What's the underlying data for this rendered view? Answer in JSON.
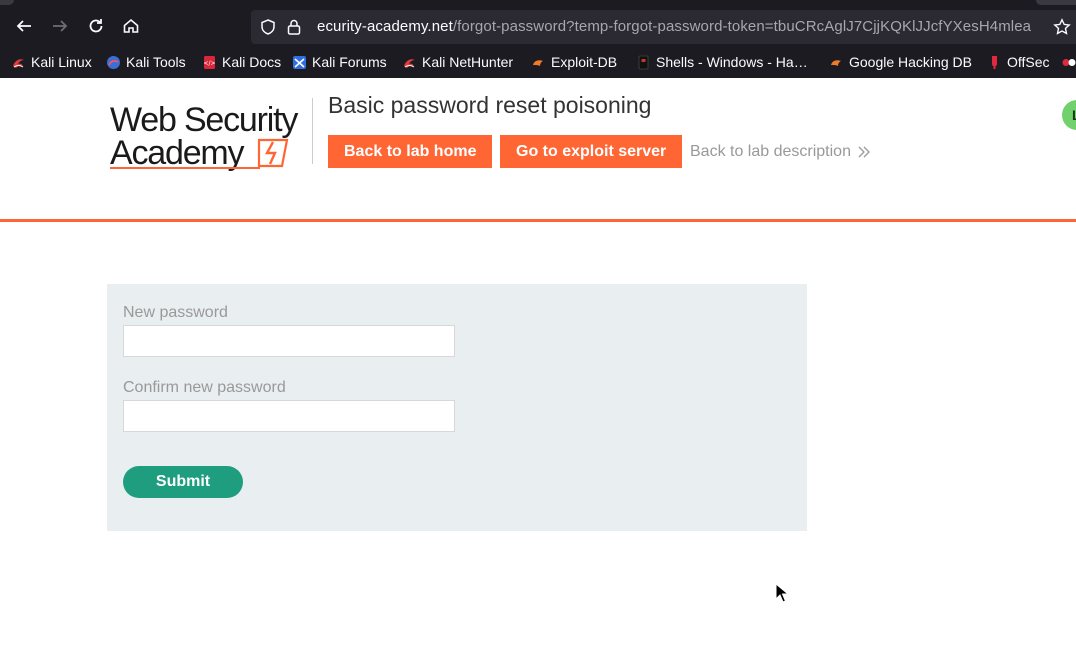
{
  "browser": {
    "url_host": "ecurity-academy.net",
    "url_path": "/forgot-password?temp-forgot-password-token=tbuCRcAglJ7CjjKQKlJJcfYXesH4mlea",
    "bookmarks": [
      {
        "label": "Kali Linux",
        "icon": "kali-dragon-icon"
      },
      {
        "label": "Kali Tools",
        "icon": "kali-tools-icon"
      },
      {
        "label": "Kali Docs",
        "icon": "kali-docs-icon"
      },
      {
        "label": "Kali Forums",
        "icon": "kali-forums-icon"
      },
      {
        "label": "Kali NetHunter",
        "icon": "kali-nethunter-icon"
      },
      {
        "label": "Exploit-DB",
        "icon": "exploit-db-icon"
      },
      {
        "label": "Shells - Windows - Ha…",
        "icon": "shells-icon"
      },
      {
        "label": "Google Hacking DB",
        "icon": "ghdb-icon"
      },
      {
        "label": "OffSec",
        "icon": "offsec-icon"
      }
    ]
  },
  "header": {
    "logo_line1": "Web Security",
    "logo_line2": "Academy",
    "lab_title": "Basic password reset poisoning",
    "back_to_lab_home": "Back to lab home",
    "go_to_exploit_server": "Go to exploit server",
    "back_to_lab_description": "Back to lab description",
    "status_initial": "L"
  },
  "form": {
    "new_password_label": "New password",
    "new_password_value": "",
    "confirm_password_label": "Confirm new password",
    "confirm_password_value": "",
    "submit_label": "Submit"
  },
  "colors": {
    "accent_orange": "#ff6633",
    "submit_green": "#1f9e7f",
    "panel_bg": "#e9eef0"
  }
}
